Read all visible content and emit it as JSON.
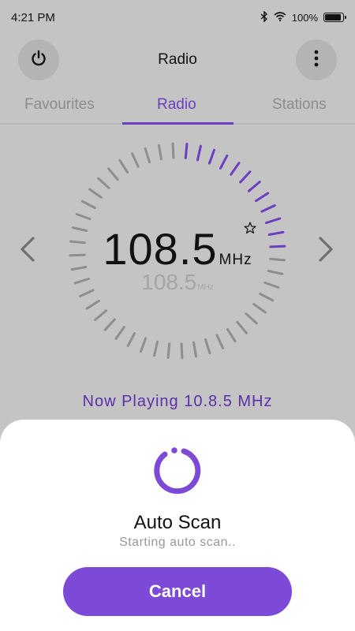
{
  "status_bar": {
    "time": "4:21 PM",
    "battery_text": "100%",
    "battery_level": 1.0,
    "icons": [
      "bluetooth-icon",
      "wifi-icon",
      "battery-icon"
    ]
  },
  "app_bar": {
    "title": "Radio",
    "left_icon": "power-icon",
    "right_icon": "more-vertical-icon"
  },
  "tabs": [
    {
      "label": "Favourites",
      "active": false
    },
    {
      "label": "Radio",
      "active": true
    },
    {
      "label": "Stations",
      "active": false
    }
  ],
  "tuner": {
    "frequency": "108.5",
    "unit": "MHz",
    "secondary_frequency": "108.5",
    "secondary_unit": "MHz",
    "favourite_icon": "star-outline-icon",
    "prev_icon": "chevron-left-icon",
    "next_icon": "chevron-right-icon",
    "dial_progress": 0.25
  },
  "now_playing": "Now Playing 10.8.5 MHz",
  "sheet": {
    "title": "Auto Scan",
    "subtitle": "Starting auto scan..",
    "cancel_label": "Cancel",
    "spinner_icon": "loading-spinner-icon"
  },
  "colors": {
    "accent": "#7d4ad7",
    "accent_dark": "#6b3fc0",
    "overlay_bg": "#c4c4c4",
    "tick_inactive": "#8e8e8e"
  }
}
